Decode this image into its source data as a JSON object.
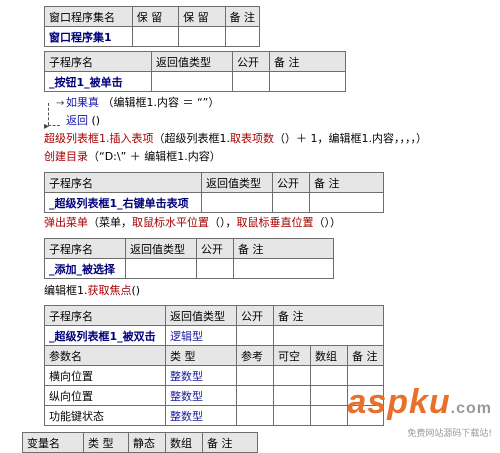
{
  "table1": {
    "headers": [
      "窗口程序集名",
      "保 留",
      "保 留",
      "备 注"
    ],
    "row": [
      "窗口程序集1",
      "",
      "",
      ""
    ]
  },
  "table2": {
    "headers": [
      "子程序名",
      "返回值类型",
      "公开",
      "备 注"
    ],
    "row": [
      "_按钮1_被单击",
      "",
      "",
      ""
    ]
  },
  "code1": {
    "if_kw": "如果真",
    "if_args": "（编辑框1.内容 ＝ “”）",
    "return_kw": "返回",
    "return_args": "()",
    "insert_fn": "超级列表框1.插入表项",
    "insert_args_a": "（超级列表框1.",
    "insert_fn2": "取表项数",
    "insert_args_b": "（）＋ 1，编辑框1.内容，，，，）",
    "mkdir_fn": "创建目录",
    "mkdir_args": "（“D:\\” ＋ 编辑框1.内容）"
  },
  "table3": {
    "headers": [
      "子程序名",
      "返回值类型",
      "公开",
      "备 注"
    ],
    "row": [
      "_超级列表框1_右键单击表项",
      "",
      "",
      ""
    ]
  },
  "code2": {
    "popup_fn": "弹出菜单",
    "popup_args_a": "（菜单，",
    "popup_fn2": "取鼠标水平位置",
    "popup_args_b": "（），",
    "popup_fn3": "取鼠标垂直位置",
    "popup_args_c": "（））"
  },
  "table4": {
    "headers": [
      "子程序名",
      "返回值类型",
      "公开",
      "备 注"
    ],
    "row": [
      "_添加_被选择",
      "",
      "",
      ""
    ]
  },
  "code3": {
    "focus_obj": "编辑框1.",
    "focus_fn": "获取焦点",
    "focus_args": "()"
  },
  "table5": {
    "headers": [
      "子程序名",
      "返回值类型",
      "公开",
      "备 注"
    ],
    "row": [
      "_超级列表框1_被双击",
      "逻辑型",
      "",
      ""
    ],
    "param_headers": [
      "参数名",
      "类 型",
      "参考",
      "可空",
      "数组",
      "备 注"
    ],
    "params": [
      [
        "横向位置",
        "整数型",
        "",
        "",
        "",
        ""
      ],
      [
        "纵向位置",
        "整数型",
        "",
        "",
        "",
        ""
      ],
      [
        "功能键状态",
        "整数型",
        "",
        "",
        "",
        ""
      ]
    ]
  },
  "table6": {
    "headers": [
      "变量名",
      "类 型",
      "静态",
      "数组",
      "备 注"
    ]
  },
  "watermark": {
    "logo": "aspku",
    "dotcom": ".com",
    "sub": "免费网站源码下载站!"
  },
  "colors": {
    "keyword": "#1515a8",
    "function": "#a60000",
    "logo": "#e8702a"
  }
}
